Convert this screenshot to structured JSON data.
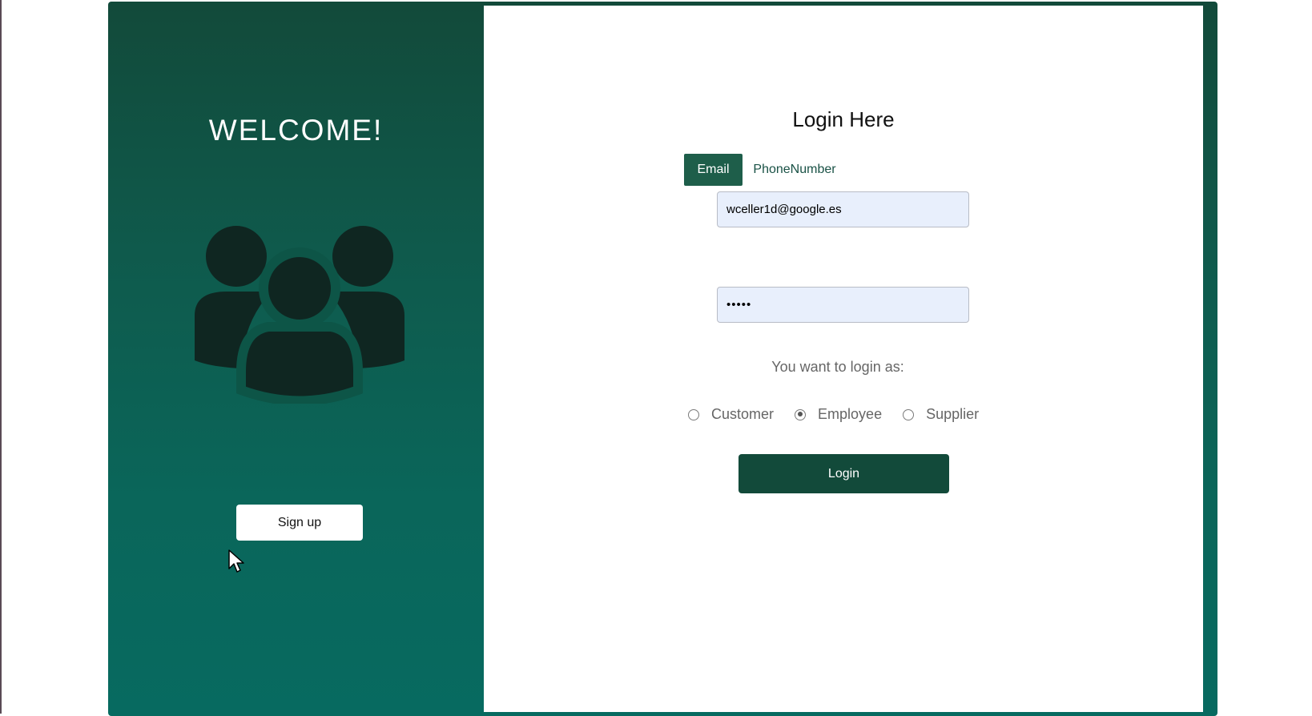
{
  "left": {
    "welcome": "WELCOME!",
    "signup_label": "Sign up"
  },
  "right": {
    "title": "Login Here",
    "tabs": [
      {
        "label": "Email",
        "active": true
      },
      {
        "label": "PhoneNumber",
        "active": false
      }
    ],
    "email_value": "wceller1d@google.es",
    "password_value": "•••••",
    "login_as_label": "You want to login as:",
    "roles": [
      {
        "label": "Customer",
        "checked": false
      },
      {
        "label": "Employee",
        "checked": true
      },
      {
        "label": "Supplier",
        "checked": false
      }
    ],
    "login_label": "Login"
  },
  "colors": {
    "accent": "#124a3a",
    "tab_active": "#1e5e4a",
    "field_bg": "#e8effc"
  },
  "icons": [
    "users-icon",
    "cursor-icon"
  ]
}
